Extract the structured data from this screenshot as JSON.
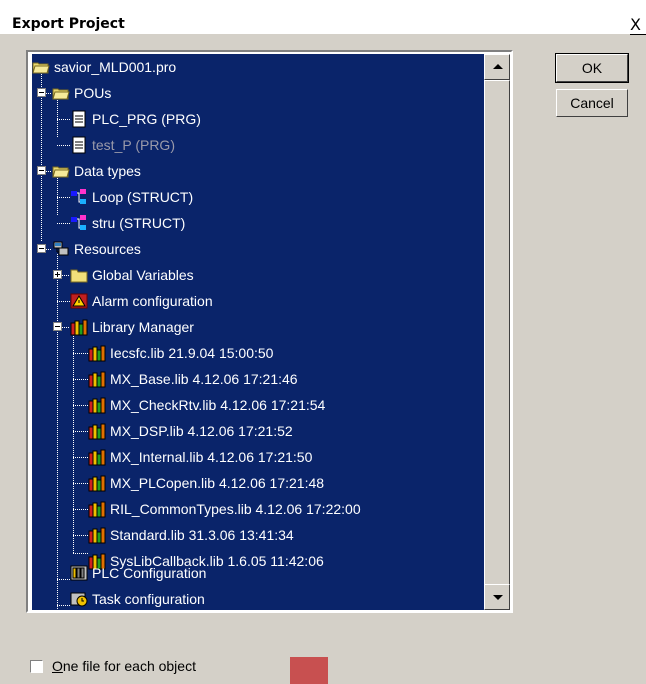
{
  "window": {
    "title": "Export Project",
    "close_glyph": "X"
  },
  "buttons": {
    "ok": "OK",
    "cancel": "Cancel"
  },
  "tree": {
    "items": [
      {
        "label": "savior_MLD001.pro",
        "icon": "folder-open-icon"
      },
      {
        "label": "POUs",
        "icon": "folder-open-icon"
      },
      {
        "label": "PLC_PRG (PRG)",
        "icon": "document-icon"
      },
      {
        "label": "test_P (PRG)",
        "icon": "document-icon"
      },
      {
        "label": "Data types",
        "icon": "folder-open-icon"
      },
      {
        "label": "Loop (STRUCT)",
        "icon": "struct-icon"
      },
      {
        "label": "stru (STRUCT)",
        "icon": "struct-icon"
      },
      {
        "label": "Resources",
        "icon": "resources-icon"
      },
      {
        "label": "Global Variables",
        "icon": "folder-closed-icon"
      },
      {
        "label": "Alarm configuration",
        "icon": "alarm-icon"
      },
      {
        "label": "Library Manager",
        "icon": "library-icon"
      },
      {
        "label": "Iecsfc.lib 21.9.04 15:00:50",
        "icon": "library-icon"
      },
      {
        "label": "MX_Base.lib 4.12.06 17:21:46",
        "icon": "library-icon"
      },
      {
        "label": "MX_CheckRtv.lib 4.12.06 17:21:54",
        "icon": "library-icon"
      },
      {
        "label": "MX_DSP.lib 4.12.06 17:21:52",
        "icon": "library-icon"
      },
      {
        "label": "MX_Internal.lib 4.12.06 17:21:50",
        "icon": "library-icon"
      },
      {
        "label": "MX_PLCopen.lib 4.12.06 17:21:48",
        "icon": "library-icon"
      },
      {
        "label": "RIL_CommonTypes.lib 4.12.06 17:22:00",
        "icon": "library-icon"
      },
      {
        "label": "Standard.lib 31.3.06 13:41:34",
        "icon": "library-icon"
      },
      {
        "label": "SysLibCallback.lib 1.6.05 11:42:06",
        "icon": "library-icon"
      },
      {
        "label": "PLC Configuration",
        "icon": "plc-config-icon"
      },
      {
        "label": "Task configuration",
        "icon": "task-config-icon"
      }
    ]
  },
  "options": {
    "one_file_prefix": "O",
    "one_file_rest": "ne file for each object",
    "one_file_checked": false
  },
  "colors": {
    "selection": "#0a246a",
    "dialog": "#d4d0c8",
    "marker": "#c85050"
  }
}
